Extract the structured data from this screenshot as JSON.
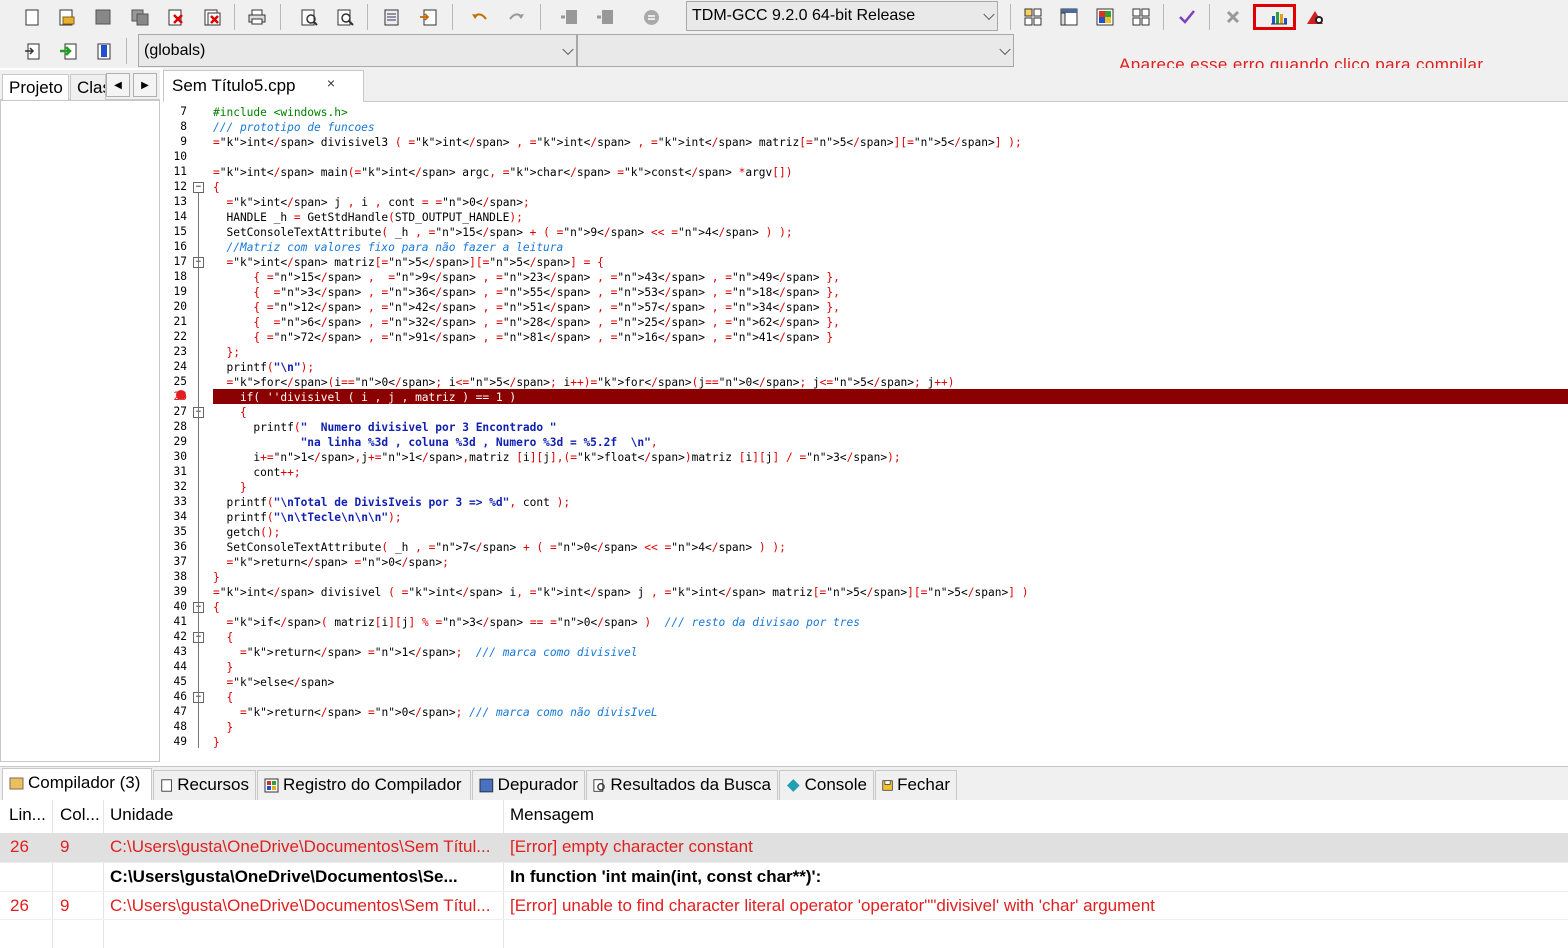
{
  "toolbar": {
    "compiler_select": "TDM-GCC 9.2.0 64-bit Release",
    "scope_select": "(globals)",
    "function_select": ""
  },
  "annotation": "Aparece esse erro quando clico para compilar",
  "left_tabs": {
    "project": "Projeto",
    "classes": "Clas"
  },
  "editor": {
    "tab_title": "Sem Título5.cpp",
    "close_glyph": "×"
  },
  "code_lines": [
    {
      "n": "7",
      "t": "#include <windows.h>"
    },
    {
      "n": "8",
      "t": "/// prototipo de funcoes"
    },
    {
      "n": "9",
      "t": "int divisivel3 ( int , int , int matriz[5][5] );"
    },
    {
      "n": "10",
      "t": ""
    },
    {
      "n": "11",
      "t": "int main(int argc, char const *argv[])"
    },
    {
      "n": "12",
      "t": "{"
    },
    {
      "n": "13",
      "t": "  int j , i , cont = 0;"
    },
    {
      "n": "14",
      "t": "  HANDLE _h = GetStdHandle(STD_OUTPUT_HANDLE);"
    },
    {
      "n": "15",
      "t": "  SetConsoleTextAttribute( _h , 15 + ( 9 << 4 ) );"
    },
    {
      "n": "16",
      "t": "  //Matriz com valores fixo para não fazer a leitura"
    },
    {
      "n": "17",
      "t": "  int matriz[5][5] = {"
    },
    {
      "n": "18",
      "t": "      { 15 ,  9 , 23 , 43 , 49 },"
    },
    {
      "n": "19",
      "t": "      {  3 , 36 , 55 , 53 , 18 },"
    },
    {
      "n": "20",
      "t": "      { 12 , 42 , 51 , 57 , 34 },"
    },
    {
      "n": "21",
      "t": "      {  6 , 32 , 28 , 25 , 62 },"
    },
    {
      "n": "22",
      "t": "      { 72 , 91 , 81 , 16 , 41 }"
    },
    {
      "n": "23",
      "t": "  };"
    },
    {
      "n": "24",
      "t": "  printf(\"\\n\");"
    },
    {
      "n": "25",
      "t": "  for(i=0; i<5; i++)for(j=0; j<5; j++)"
    },
    {
      "n": "26",
      "t": "    if( ''divisivel ( i , j , matriz ) == 1 )"
    },
    {
      "n": "27",
      "t": "    {"
    },
    {
      "n": "28",
      "t": "      printf(\"  Numero divisivel por 3 Encontrado \""
    },
    {
      "n": "29",
      "t": "             \"na linha %3d , coluna %3d , Numero %3d = %5.2f  \\n\","
    },
    {
      "n": "30",
      "t": "      i+1,j+1,matriz [i][j],(float)matriz [i][j] / 3);"
    },
    {
      "n": "31",
      "t": "      cont++;"
    },
    {
      "n": "32",
      "t": "    }"
    },
    {
      "n": "33",
      "t": "  printf(\"\\nTotal de DivisIveis por 3 => %d\", cont );"
    },
    {
      "n": "34",
      "t": "  printf(\"\\n\\tTecle\\n\\n\\n\");"
    },
    {
      "n": "35",
      "t": "  getch();"
    },
    {
      "n": "36",
      "t": "  SetConsoleTextAttribute( _h , 7 + ( 0 << 4 ) );"
    },
    {
      "n": "37",
      "t": "  return 0;"
    },
    {
      "n": "38",
      "t": "}"
    },
    {
      "n": "39",
      "t": "int divisivel ( int i, int j , int matriz[5][5] )"
    },
    {
      "n": "40",
      "t": "{"
    },
    {
      "n": "41",
      "t": "  if( matriz[i][j] % 3 == 0 )  /// resto da divisao por tres"
    },
    {
      "n": "42",
      "t": "  {"
    },
    {
      "n": "43",
      "t": "    return 1;  /// marca como divisivel"
    },
    {
      "n": "44",
      "t": "  }"
    },
    {
      "n": "45",
      "t": "  else"
    },
    {
      "n": "46",
      "t": "  {"
    },
    {
      "n": "47",
      "t": "    return 0; /// marca como não divisIveL"
    },
    {
      "n": "48",
      "t": "  }"
    },
    {
      "n": "49",
      "t": "}"
    }
  ],
  "bottom_tabs": [
    "Compilador (3)",
    "Recursos",
    "Registro do Compilador",
    "Depurador",
    "Resultados da Busca",
    "Console",
    "Fechar"
  ],
  "messages": {
    "headers": {
      "line": "Lin...",
      "col": "Col...",
      "unit": "Unidade",
      "message": "Mensagem"
    },
    "rows": [
      {
        "line": "26",
        "col": "9",
        "unit": "C:\\Users\\gusta\\OneDrive\\Documentos\\Sem Títul...",
        "message": "[Error] empty character constant"
      },
      {
        "line": "",
        "col": "",
        "unit": "C:\\Users\\gusta\\OneDrive\\Documentos\\Se...",
        "message": "In function 'int main(int, const char**)':"
      },
      {
        "line": "26",
        "col": "9",
        "unit": "C:\\Users\\gusta\\OneDrive\\Documentos\\Sem Títul...",
        "message": "[Error] unable to find character literal operator 'operator\"\"divisivel' with 'char' argument"
      }
    ]
  },
  "colors": {
    "error_line": "#8b0000",
    "error_text": "#e02020",
    "annotation": "#e02020",
    "highlight_box": "#e00000",
    "selected_row": "#e0e0e0"
  }
}
